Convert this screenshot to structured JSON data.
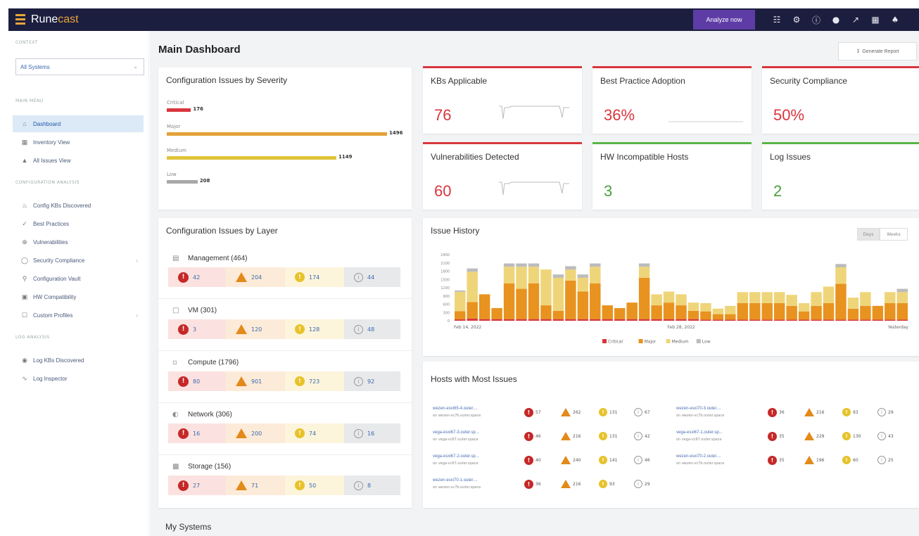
{
  "app": {
    "brand_a": "Rune",
    "brand_b": "cast",
    "analyze_label": "Analyze now"
  },
  "topicons": [
    "people-icon",
    "gear-icon",
    "help-icon",
    "chat-icon",
    "link-icon",
    "book-icon",
    "user-icon"
  ],
  "sidebar": {
    "context_label": "CONTEXT",
    "context_value": "All Systems",
    "main_menu_label": "MAIN MENU",
    "main_items": [
      {
        "label": "Dashboard",
        "icon": "home-icon"
      },
      {
        "label": "Inventory View",
        "icon": "grid-icon"
      },
      {
        "label": "All Issues View",
        "icon": "flask-icon"
      }
    ],
    "config_label": "CONFIGURATION ANALYSIS",
    "config_items": [
      {
        "label": "Config KBs Discovered",
        "icon": "bulb-icon"
      },
      {
        "label": "Best Practices",
        "icon": "check-circle-icon"
      },
      {
        "label": "Vulnerabilities",
        "icon": "crosshair-icon"
      },
      {
        "label": "Security Compliance",
        "icon": "shield-icon"
      },
      {
        "label": "Configuration Vault",
        "icon": "key-icon"
      },
      {
        "label": "HW Compatibility",
        "icon": "chip-icon"
      },
      {
        "label": "Custom Profiles",
        "icon": "doc-icon"
      }
    ],
    "log_label": "LOG ANALYSIS",
    "log_items": [
      {
        "label": "Log KBs Discovered",
        "icon": "eye-icon"
      },
      {
        "label": "Log Inspector",
        "icon": "wave-icon"
      }
    ]
  },
  "page": {
    "title": "Main Dashboard",
    "generate_report": "Generate Report",
    "my_systems": "My Systems"
  },
  "severity": {
    "title": "Configuration Issues by Severity",
    "rows": [
      {
        "label": "Critical",
        "value": "176",
        "frac": 0.11,
        "color": "#d9363e"
      },
      {
        "label": "Major",
        "value": "1496",
        "frac": 1.0,
        "color": "#e3a33a"
      },
      {
        "label": "Medium",
        "value": "1149",
        "frac": 0.77,
        "color": "#e0c43a"
      },
      {
        "label": "Low",
        "value": "208",
        "frac": 0.14,
        "color": "#a8a8a8"
      }
    ]
  },
  "kpis": [
    {
      "title": "KBs Applicable",
      "value": "76",
      "color": "#d9363e"
    },
    {
      "title": "Best Practice Adoption",
      "value": "36%",
      "color": "#d9363e"
    },
    {
      "title": "Security Compliance",
      "value": "50%",
      "color": "#d9363e"
    },
    {
      "title": "Vulnerabilities Detected",
      "value": "60",
      "color": "#d9363e"
    },
    {
      "title": "HW Incompatible Hosts",
      "value": "3",
      "color": "#4ba03c"
    },
    {
      "title": "Log Issues",
      "value": "2",
      "color": "#4ba03c"
    }
  ],
  "layers": {
    "title": "Configuration Issues by Layer",
    "rows": [
      {
        "name": "Management (464)",
        "crit": "42",
        "maj": "204",
        "med": "174",
        "low": "44",
        "icon": "server-icon"
      },
      {
        "name": "VM (301)",
        "crit": "3",
        "maj": "120",
        "med": "128",
        "low": "48",
        "icon": "monitor-icon"
      },
      {
        "name": "Compute (1796)",
        "crit": "80",
        "maj": "901",
        "med": "723",
        "low": "92",
        "icon": "compute-icon"
      },
      {
        "name": "Network (306)",
        "crit": "16",
        "maj": "200",
        "med": "74",
        "low": "16",
        "icon": "globe-icon"
      },
      {
        "name": "Storage (156)",
        "crit": "27",
        "maj": "71",
        "med": "50",
        "low": "8",
        "icon": "storage-icon"
      }
    ]
  },
  "history": {
    "title": "Issue History",
    "toggle_days": "Days",
    "toggle_weeks": "Weeks",
    "x_start": "Feb 14, 2022",
    "x_mid": "Feb 28, 2022",
    "x_end": "Yesterday",
    "legend": [
      "Critical",
      "Major",
      "Medium",
      "Low"
    ]
  },
  "chart_data": {
    "type": "bar",
    "stacked": true,
    "yticks": [
      "0",
      "300",
      "600",
      "900",
      "1200",
      "1500",
      "1800",
      "2100",
      "2400"
    ],
    "ylim": [
      0,
      2400
    ],
    "series": [
      {
        "name": "Critical",
        "color": "#d9363e",
        "values": [
          50,
          80,
          60,
          60,
          60,
          60,
          60,
          60,
          60,
          60,
          60,
          60,
          60,
          60,
          60,
          60,
          60,
          60,
          60,
          60,
          40,
          40,
          40,
          40,
          40,
          40,
          40,
          40,
          40,
          40,
          40,
          40,
          40,
          40,
          40,
          40,
          40
        ]
      },
      {
        "name": "Major",
        "color": "#e8931f",
        "values": [
          300,
          600,
          900,
          400,
          1300,
          1100,
          1300,
          500,
          300,
          1400,
          1000,
          1300,
          500,
          400,
          600,
          1500,
          500,
          600,
          500,
          300,
          300,
          200,
          200,
          600,
          600,
          600,
          600,
          500,
          300,
          500,
          600,
          1300,
          400,
          500,
          500,
          600,
          600
        ]
      },
      {
        "name": "Medium",
        "color": "#efd57a",
        "values": [
          700,
          1100,
          0,
          0,
          600,
          800,
          600,
          1300,
          1200,
          400,
          500,
          600,
          0,
          0,
          0,
          400,
          400,
          400,
          400,
          300,
          300,
          200,
          300,
          400,
          400,
          400,
          400,
          400,
          300,
          500,
          600,
          600,
          400,
          500,
          0,
          400,
          400
        ]
      },
      {
        "name": "Low",
        "color": "#bcbcbc",
        "values": [
          50,
          120,
          0,
          0,
          120,
          120,
          120,
          0,
          120,
          120,
          120,
          120,
          0,
          0,
          0,
          120,
          0,
          0,
          0,
          0,
          0,
          0,
          0,
          0,
          0,
          0,
          0,
          0,
          0,
          0,
          0,
          120,
          0,
          0,
          0,
          0,
          120
        ]
      }
    ]
  },
  "hosts": {
    "title": "Hosts with Most Issues",
    "rows": [
      {
        "name": "wezen-esxi65-4.outer....",
        "sub": "on wezen-vc7b.outer.space",
        "crit": "57",
        "maj": "262",
        "med": "131",
        "low": "67"
      },
      {
        "name": "vega-esxi67-3.outer.sp...",
        "sub": "on vega-vc67.outer.space",
        "crit": "46",
        "maj": "216",
        "med": "131",
        "low": "42"
      },
      {
        "name": "vega-esxi67-2.outer.sp...",
        "sub": "on vega-vc67.outer.space",
        "crit": "40",
        "maj": "240",
        "med": "141",
        "low": "46"
      },
      {
        "name": "wezen-esxi70-1.outer....",
        "sub": "on wezen-vc7b.outer.space",
        "crit": "36",
        "maj": "216",
        "med": "93",
        "low": "29"
      },
      {
        "name": "wezen-esxi70-3.outer....",
        "sub": "on wezen-vc7b.outer.space",
        "crit": "36",
        "maj": "216",
        "med": "93",
        "low": "29"
      },
      {
        "name": "vega-esxi67-1.outer.sp...",
        "sub": "on vega-vc67.outer.space",
        "crit": "35",
        "maj": "229",
        "med": "130",
        "low": "43"
      },
      {
        "name": "wezen-esxi70-2.outer....",
        "sub": "on wezen-vc7b.outer.space",
        "crit": "35",
        "maj": "196",
        "med": "60",
        "low": "25"
      }
    ]
  }
}
